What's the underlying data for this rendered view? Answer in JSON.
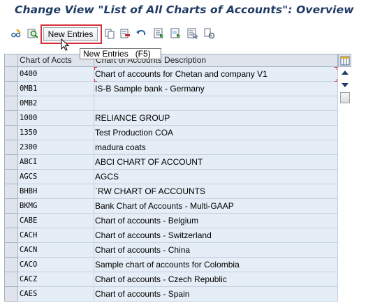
{
  "window": {
    "title": "Change View \"List of All Charts of Accounts\": Overview"
  },
  "toolbar": {
    "icons": [
      "glasses-edit-icon",
      "find-icon"
    ],
    "new_entries_label": "New Entries",
    "tail_icons": [
      "copy-icon",
      "delete-icon",
      "undo-icon",
      "select-all-icon",
      "select-block-icon",
      "deselect-all-icon",
      "config-icon"
    ]
  },
  "tooltip": {
    "label": "New Entries",
    "shortcut": "(F5)"
  },
  "table": {
    "columns": [
      "Chart of Accts",
      "Chart of Accounts Description"
    ],
    "rows": [
      {
        "code": "0400",
        "description": "Chart of accounts for Chetan and company V1"
      },
      {
        "code": "0MB1",
        "description": "IS-B Sample bank - Germany"
      },
      {
        "code": "0MB2",
        "description": ""
      },
      {
        "code": "1000",
        "description": "RELIANCE GROUP"
      },
      {
        "code": "1350",
        "description": "Test Production COA"
      },
      {
        "code": "2300",
        "description": "madura coats"
      },
      {
        "code": "ABCI",
        "description": "ABCI CHART OF ACCOUNT"
      },
      {
        "code": "AGCS",
        "description": "AGCS"
      },
      {
        "code": "BHBH",
        "description": "`RW CHART OF ACCOUNTS"
      },
      {
        "code": "BKMG",
        "description": "Bank Chart of Accounts - Multi-GAAP"
      },
      {
        "code": "CABE",
        "description": "Chart of accounts - Belgium"
      },
      {
        "code": "CACH",
        "description": "Chart of accounts - Switzerland"
      },
      {
        "code": "CACN",
        "description": "Chart of accounts - China"
      },
      {
        "code": "CACO",
        "description": "Sample chart of accounts for Colombia"
      },
      {
        "code": "CACZ",
        "description": "Chart of accounts - Czech Republic"
      },
      {
        "code": "CAES",
        "description": "Chart of accounts - Spain"
      }
    ]
  },
  "colors": {
    "title": "#1f3a64",
    "highlight_border": "#d8303a",
    "row_background": "#e5edf6",
    "header_background": "#dfe4ec"
  }
}
